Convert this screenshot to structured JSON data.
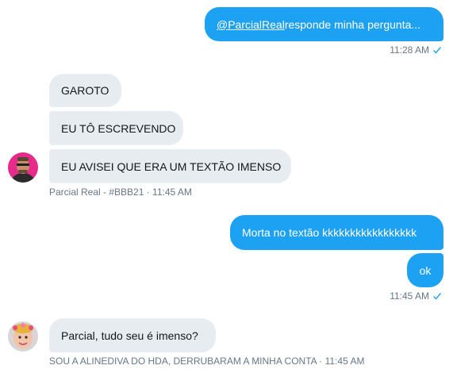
{
  "messages": {
    "m1": {
      "mention": "@ParcialReal",
      "text": " responde minha pergunta...",
      "time": "11:28 AM"
    },
    "m2": {
      "text": "GAROTO"
    },
    "m3": {
      "text": "EU TÔ ESCREVENDO"
    },
    "m4": {
      "text": "EU AVISEI QUE ERA UM TEXTÃO IMENSO"
    },
    "m4_meta": "Parcial Real - #BBB21 · 11:45 AM",
    "m5": {
      "text": "Morta no textão kkkkkkkkkkkkkkkkk"
    },
    "m6": {
      "text": "ok",
      "time": "11:45 AM"
    },
    "m7": {
      "text": "Parcial, tudo seu é imenso?"
    },
    "m7_meta": "SOU A ALINEDIVA DO HDA, DERRUBARAM A MINHA CONTA · 11:45 AM"
  },
  "colors": {
    "accent": "#1da1f2",
    "incoming_bg": "#e6ecf0",
    "meta_text": "#657786"
  },
  "icons": {
    "read_check": "check-icon"
  }
}
